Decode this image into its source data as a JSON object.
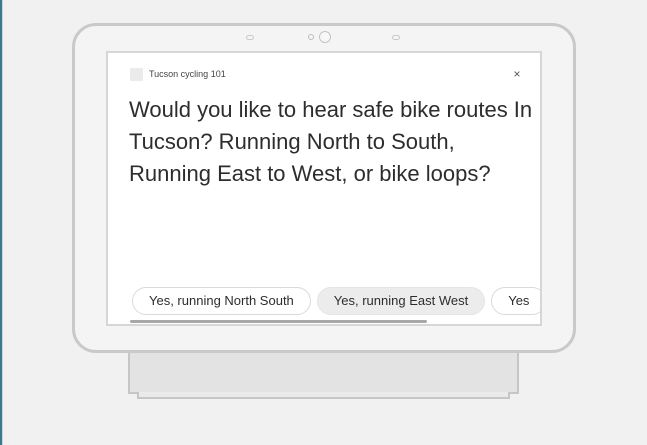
{
  "card": {
    "app_title": "Tucson cycling 101",
    "close_label": "×",
    "prompt": "Would you like to hear safe bike routes In Tucson? Running North to South, Running East to West, or bike loops?"
  },
  "chips": [
    {
      "label": "Yes, running North South",
      "selected": false
    },
    {
      "label": "Yes, running East West",
      "selected": true
    },
    {
      "label": "Yes",
      "selected": false
    }
  ],
  "scrollbar": {
    "progress": 0.72
  }
}
